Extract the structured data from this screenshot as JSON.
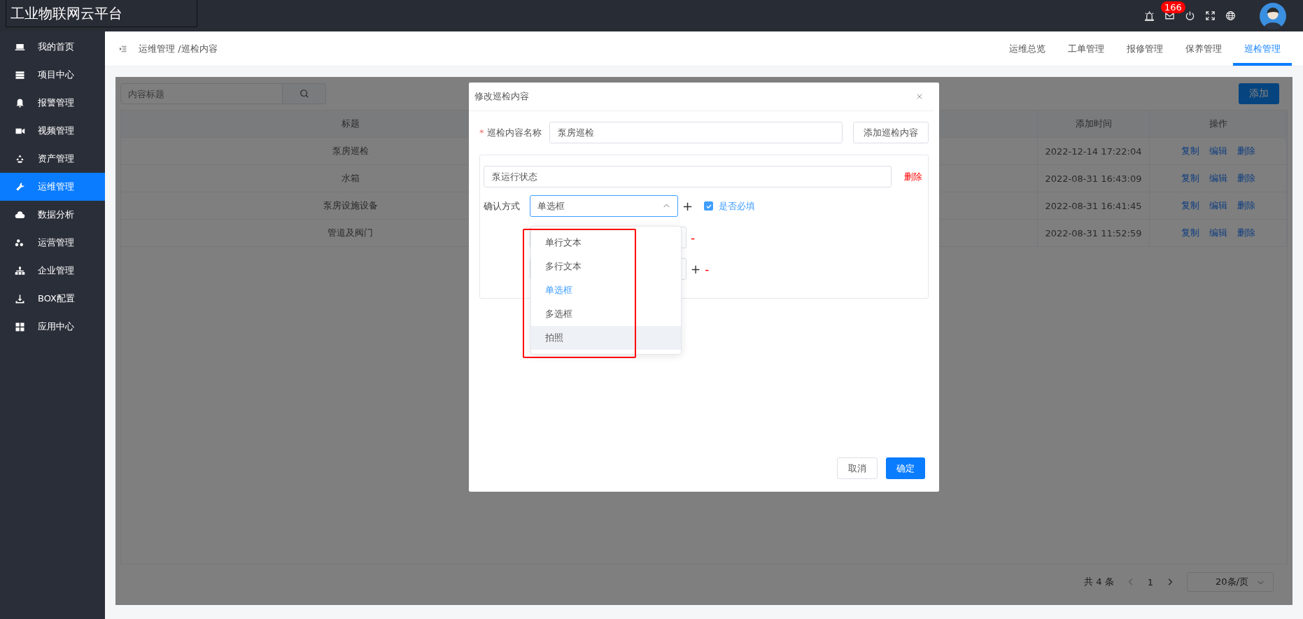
{
  "app_title": "工业物联网云平台",
  "header": {
    "notification_count": "166"
  },
  "sidebar": {
    "items": [
      {
        "label": "我的首页",
        "selected": false
      },
      {
        "label": "项目中心",
        "selected": false
      },
      {
        "label": "报警管理",
        "selected": false
      },
      {
        "label": "视频管理",
        "selected": false
      },
      {
        "label": "资产管理",
        "selected": false
      },
      {
        "label": "运维管理",
        "selected": true
      },
      {
        "label": "数据分析",
        "selected": false
      },
      {
        "label": "运营管理",
        "selected": false
      },
      {
        "label": "企业管理",
        "selected": false
      },
      {
        "label": "BOX配置",
        "selected": false
      },
      {
        "label": "应用中心",
        "selected": false
      }
    ]
  },
  "breadcrumb": "运维管理 /巡检内容",
  "tabs": [
    {
      "label": "运维总览",
      "selected": false
    },
    {
      "label": "工单管理",
      "selected": false
    },
    {
      "label": "报修管理",
      "selected": false
    },
    {
      "label": "保养管理",
      "selected": false
    },
    {
      "label": "巡检管理",
      "selected": true
    }
  ],
  "search": {
    "placeholder": "内容标题"
  },
  "add_button": "添加",
  "table": {
    "columns": {
      "title": "标题",
      "added_time": "添加时间",
      "actions": "操作"
    },
    "rows": [
      {
        "title": "泵房巡检",
        "added_time": "2022-12-14 17:22:04",
        "actions": [
          "复制",
          "编辑",
          "删除"
        ]
      },
      {
        "title": "水箱",
        "added_time": "2022-08-31 16:43:09",
        "actions": [
          "复制",
          "编辑",
          "删除"
        ]
      },
      {
        "title": "泵房设施设备",
        "added_time": "2022-08-31 16:41:45",
        "actions": [
          "复制",
          "编辑",
          "删除"
        ]
      },
      {
        "title": "管道及阀门",
        "added_time": "2022-08-31 11:52:59",
        "actions": [
          "复制",
          "编辑",
          "删除"
        ]
      }
    ]
  },
  "pagination": {
    "total": "共 4 条",
    "page": "1",
    "page_size": "20条/页"
  },
  "dialog": {
    "title": "修改巡检内容",
    "required_mark": "*",
    "name_label": "巡检内容名称",
    "name_value": "泵房巡检",
    "add_content_button": "添加巡检内容",
    "item": {
      "name_value": "泵运行状态",
      "delete_label": "删除",
      "method_label": "确认方式",
      "method_value": "单选框",
      "add_symbol": "+",
      "required_checked": true,
      "required_label": "是否必填",
      "options": [
        {
          "symbols": [
            "-"
          ]
        },
        {
          "symbols": [
            "+",
            "-"
          ]
        }
      ]
    },
    "dropdown": [
      {
        "label": "单行文本",
        "selected": false,
        "hovered": false
      },
      {
        "label": "多行文本",
        "selected": false,
        "hovered": false
      },
      {
        "label": "单选框",
        "selected": true,
        "hovered": false
      },
      {
        "label": "多选框",
        "selected": false,
        "hovered": false
      },
      {
        "label": "拍照",
        "selected": false,
        "hovered": true
      }
    ],
    "cancel_button": "取消",
    "confirm_button": "确定"
  }
}
